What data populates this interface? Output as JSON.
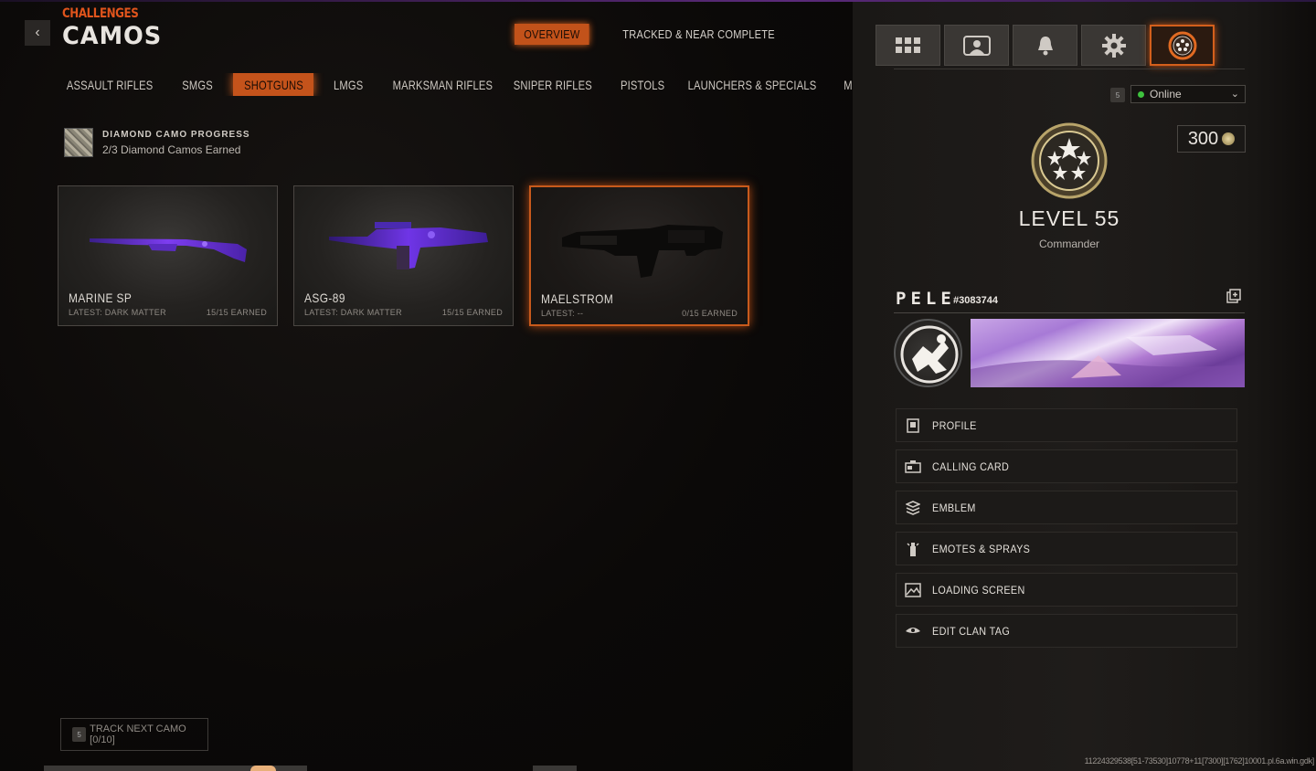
{
  "header": {
    "breadcrumb": "CHALLENGES",
    "title": "CAMOS",
    "tabs": [
      {
        "label": "OVERVIEW",
        "active": true
      },
      {
        "label": "TRACKED & NEAR COMPLETE",
        "active": false
      }
    ]
  },
  "categories": [
    {
      "label": "ASSAULT RIFLES",
      "active": false
    },
    {
      "label": "SMGS",
      "active": false
    },
    {
      "label": "SHOTGUNS",
      "active": true
    },
    {
      "label": "LMGS",
      "active": false
    },
    {
      "label": "MARKSMAN RIFLES",
      "active": false
    },
    {
      "label": "SNIPER RIFLES",
      "active": false
    },
    {
      "label": "PISTOLS",
      "active": false
    },
    {
      "label": "LAUNCHERS & SPECIALS",
      "active": false
    },
    {
      "label": "M",
      "active": false
    }
  ],
  "progress": {
    "title": "DIAMOND CAMO PROGRESS",
    "subtitle": "2/3 Diamond Camos Earned"
  },
  "weapons": [
    {
      "name": "MARINE SP",
      "latest": "LATEST: DARK MATTER",
      "earned": "15/15 EARNED",
      "selected": false
    },
    {
      "name": "ASG-89",
      "latest": "LATEST: DARK MATTER",
      "earned": "15/15 EARNED",
      "selected": false
    },
    {
      "name": "MAELSTROM",
      "latest": "LATEST: --",
      "earned": "0/15 EARNED",
      "selected": true
    }
  ],
  "track_button": {
    "key": "5",
    "label": "TRACK NEXT CAMO [0/10]"
  },
  "build_id": "11224329538[51-73530]10778+11[7300][1762]10001.pl.6a.win.gdk]",
  "sidebar": {
    "nav_icons": [
      "grid-icon",
      "party-icon",
      "bell-icon",
      "gear-icon",
      "rank-star-icon"
    ],
    "status": {
      "key": "5",
      "value": "Online"
    },
    "cp": "300",
    "level": "LEVEL 55",
    "rank": "Commander",
    "player_name": "PELE",
    "player_tag": "#3083744",
    "menu": [
      {
        "label": "PROFILE",
        "icon": "profile-icon"
      },
      {
        "label": "CALLING CARD",
        "icon": "calling-card-icon"
      },
      {
        "label": "EMBLEM",
        "icon": "emblem-icon"
      },
      {
        "label": "EMOTES & SPRAYS",
        "icon": "emote-icon"
      },
      {
        "label": "LOADING SCREEN",
        "icon": "loading-screen-icon"
      },
      {
        "label": "EDIT CLAN TAG",
        "icon": "clan-tag-icon"
      }
    ]
  },
  "colors": {
    "accent": "#c4531b",
    "online": "#3ec23e",
    "camo_purple": "#6a2bd6"
  }
}
